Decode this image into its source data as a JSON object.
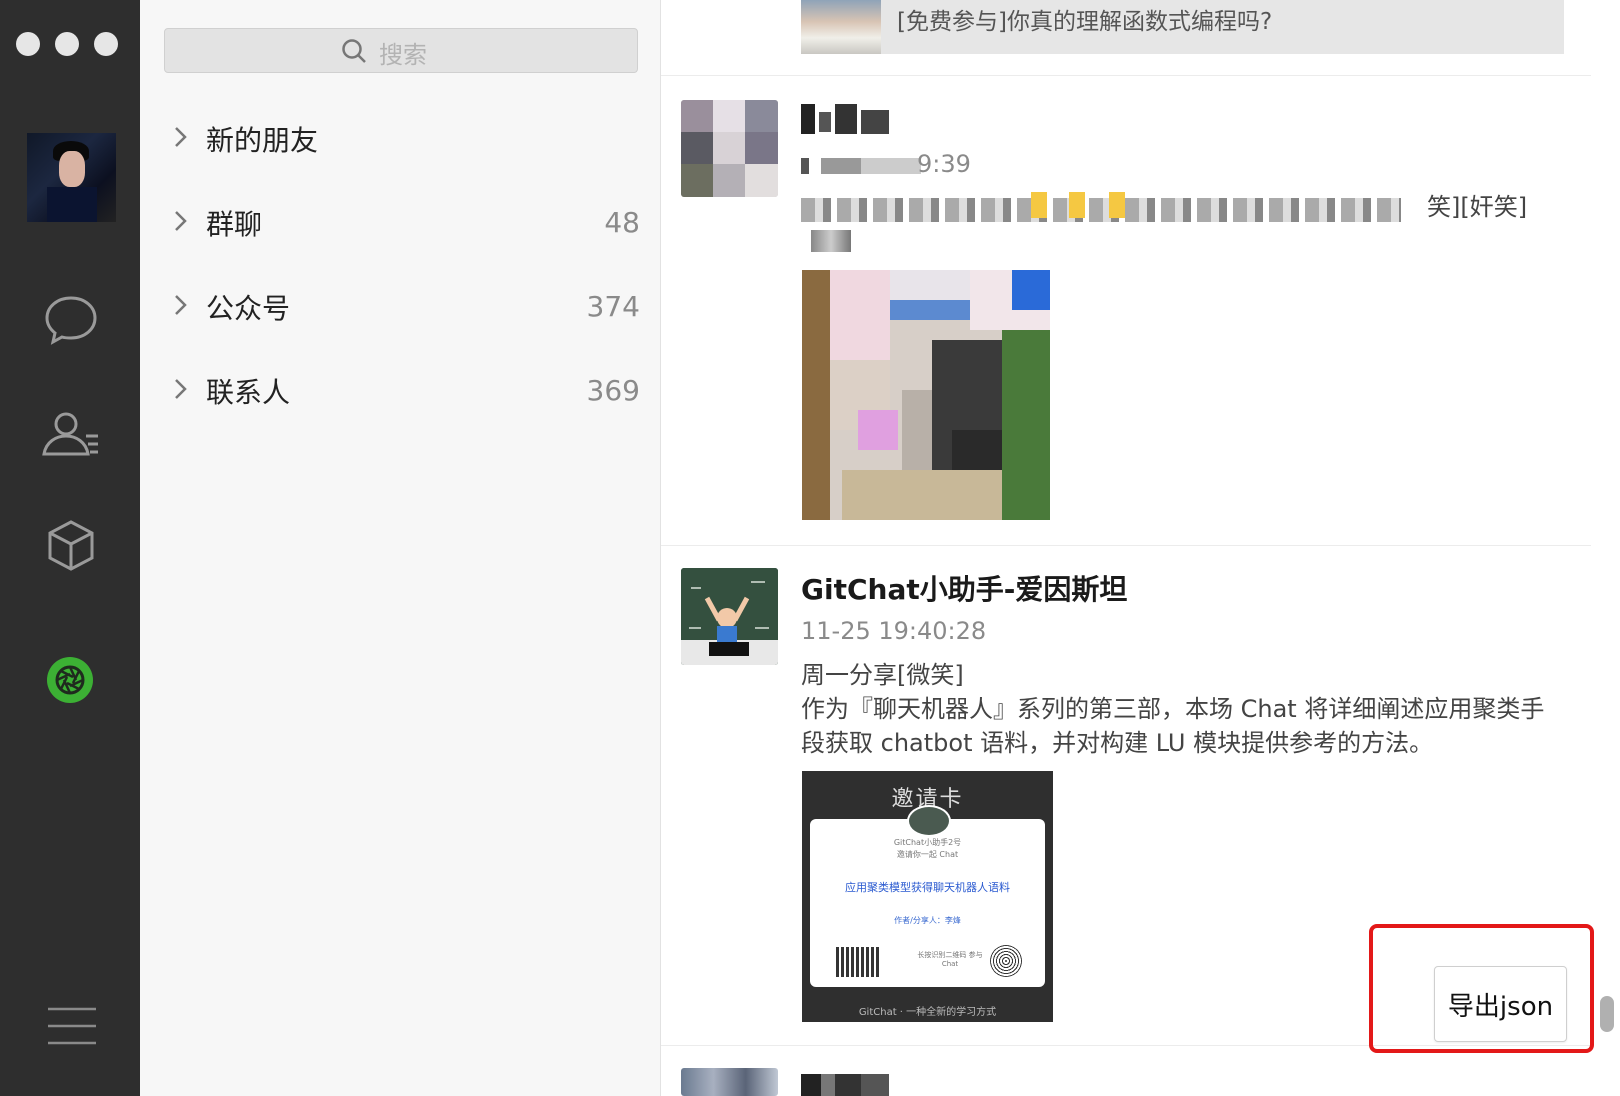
{
  "search": {
    "placeholder": "搜索"
  },
  "contact_groups": [
    {
      "label": "新的朋友",
      "count": ""
    },
    {
      "label": "群聊",
      "count": "48"
    },
    {
      "label": "公众号",
      "count": "374"
    },
    {
      "label": "联系人",
      "count": "369"
    }
  ],
  "rail": {
    "icons": [
      "chat-icon",
      "contacts-icon",
      "favorites-icon",
      "moments-icon",
      "menu-icon"
    ],
    "accent_color": "#3cb034"
  },
  "feed": {
    "previous_share_title": "[免费参与]你真的理解函数式编程吗?",
    "post1": {
      "time_visible": "9:39",
      "text_tail": "笑][奸笑]"
    },
    "post2": {
      "author": "GitChat小助手-爱因斯坦",
      "time": "11-25 19:40:28",
      "text_line1": "周一分享[微笑]",
      "text_line2": "作为『聊天机器人』系列的第三部，本场 Chat 将详细阐述应用聚类手段获取 chatbot 语料，并对构建 LU 模块提供参考的方法。",
      "card": {
        "title": "邀请卡",
        "line1": "GitChat小助手2号",
        "line2": "邀请你一起 Chat",
        "topic": "应用聚类模型获得聊天机器人语料",
        "author_line": "作者/分享人：李烽",
        "qr_hint": "长按识别二维码 参与 Chat",
        "footer": "GitChat · 一种全新的学习方式"
      }
    }
  },
  "export_button": {
    "label": "导出json"
  },
  "highlight_color": "#e31818"
}
